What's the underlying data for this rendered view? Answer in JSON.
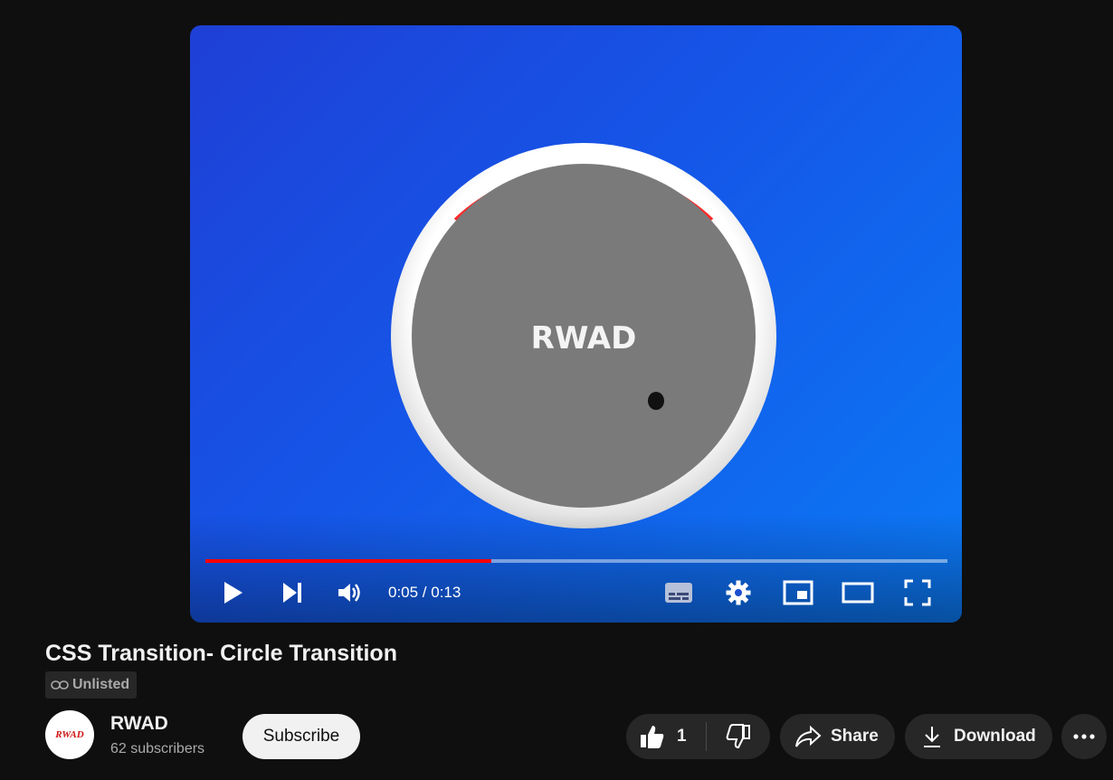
{
  "video": {
    "overlay_text": "RWAD",
    "time_display": "0:05 / 0:13",
    "progress_fraction": 0.385,
    "colors": {
      "played": "#ff0000",
      "bg_left": "#1f3fd6",
      "bg_right": "#0b7af5"
    }
  },
  "controls": {
    "icons": [
      "play-icon",
      "next-icon",
      "volume-icon",
      "subtitles-icon",
      "settings-gear-icon",
      "miniplayer-icon",
      "theater-mode-icon",
      "fullscreen-icon"
    ]
  },
  "title": "CSS Transition- Circle Transition",
  "visibility": {
    "icon": "link-icon",
    "label": "Unlisted"
  },
  "channel": {
    "avatar_text": "RWAD",
    "name": "RWAD",
    "subscribers": "62 subscribers"
  },
  "actions": {
    "subscribe": "Subscribe",
    "like_count": "1",
    "share": "Share",
    "download": "Download"
  }
}
